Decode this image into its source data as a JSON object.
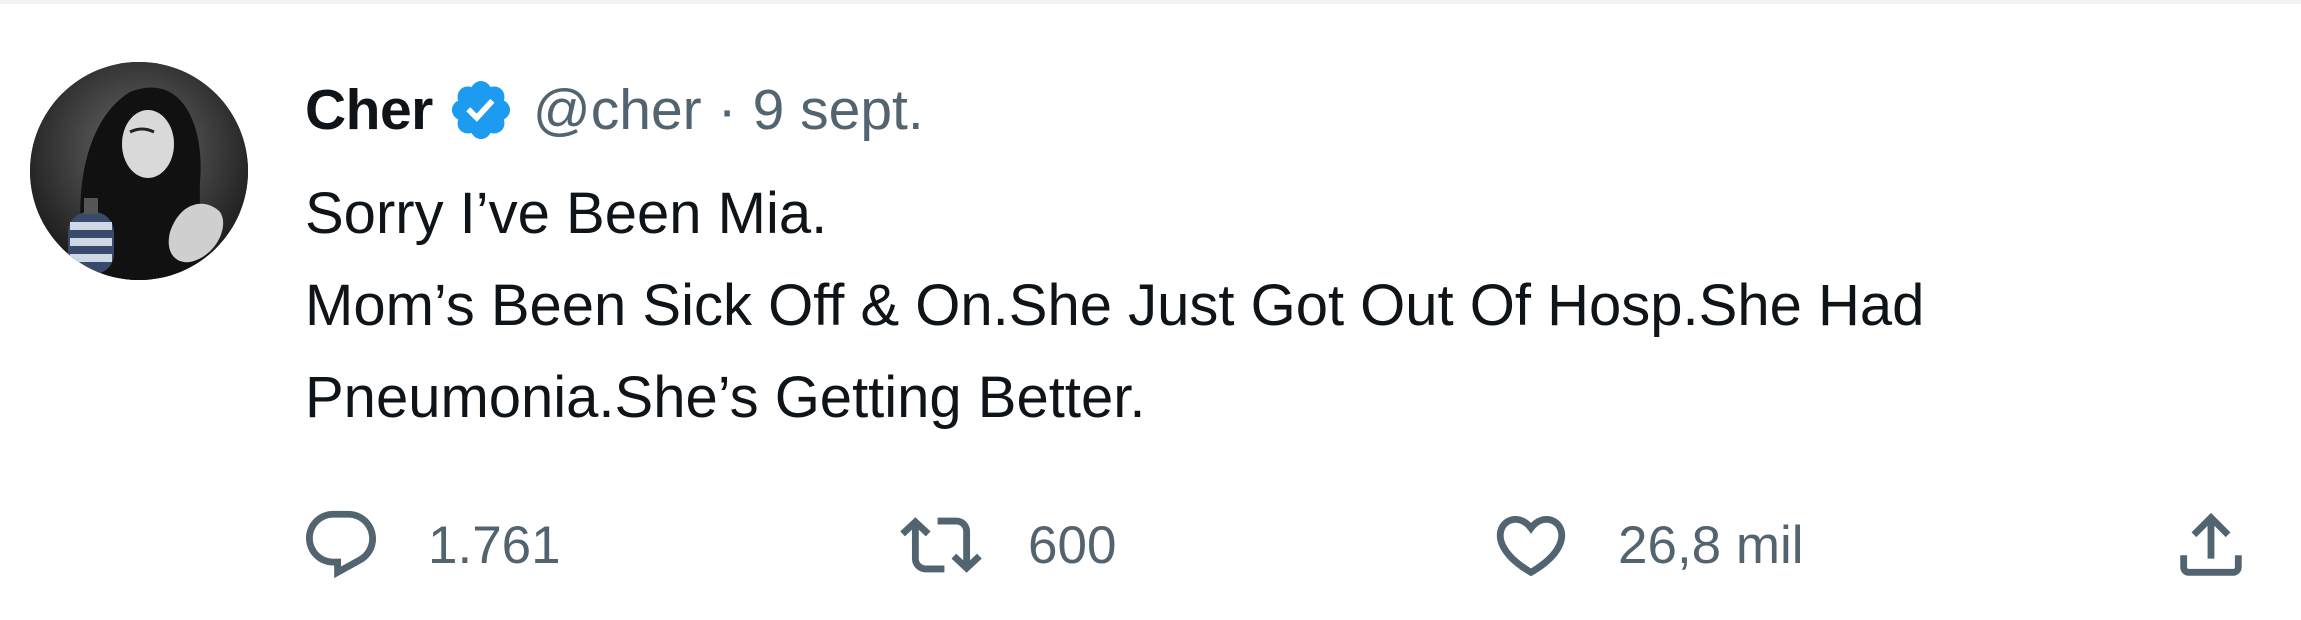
{
  "tweet": {
    "author": {
      "display_name": "Cher",
      "handle": "@cher",
      "verified": true,
      "avatar_icon": "profile-photo"
    },
    "separator": "·",
    "timestamp": "9 sept.",
    "text_lines": [
      "Sorry I’ve Been Mia.",
      "Mom’s Been Sick Off & On.She Just Got Out Of Hosp.She Had",
      "Pneumonia.She’s Getting Better."
    ],
    "actions": {
      "reply": {
        "icon": "reply-icon",
        "count": "1.761"
      },
      "retweet": {
        "icon": "retweet-icon",
        "count": "600"
      },
      "like": {
        "icon": "heart-icon",
        "count": "26,8 mil"
      },
      "share": {
        "icon": "share-icon"
      }
    }
  },
  "colors": {
    "text_primary": "#0f1419",
    "text_secondary": "#536471",
    "verified_blue": "#1d9bf0",
    "divider": "#eff3f4"
  }
}
